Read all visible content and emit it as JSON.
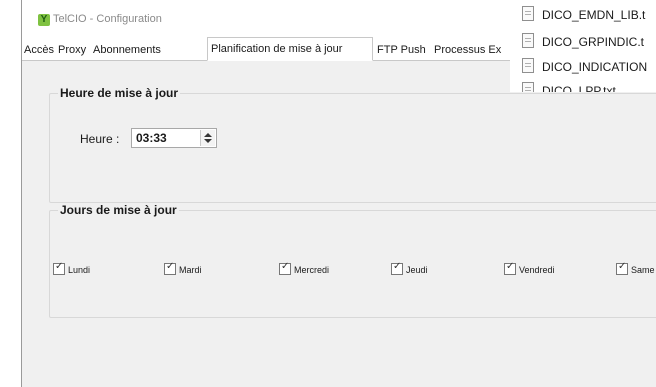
{
  "window": {
    "title": "TelCIO - Configuration"
  },
  "tabs": [
    {
      "label": "Accès"
    },
    {
      "label": "Proxy"
    },
    {
      "label": "Abonnements"
    },
    {
      "label": "Planification de mise à jour",
      "active": true
    },
    {
      "label": "FTP Push"
    },
    {
      "label": "Processus Ex"
    }
  ],
  "update_time_group": {
    "title": "Heure de mise à jour",
    "hour_label": "Heure :",
    "hour_value": "03:33"
  },
  "update_days_group": {
    "title": "Jours de mise à jour",
    "days": [
      {
        "label": "Lundi",
        "checked": true
      },
      {
        "label": "Mardi",
        "checked": true
      },
      {
        "label": "Mercredi",
        "checked": true
      },
      {
        "label": "Jeudi",
        "checked": true
      },
      {
        "label": "Vendredi",
        "checked": true
      },
      {
        "label": "Same",
        "checked": true
      }
    ]
  },
  "file_list": [
    {
      "name": "DICO_EMDN_LIB.t"
    },
    {
      "name": "DICO_GRPINDIC.t"
    },
    {
      "name": "DICO_INDICATION"
    },
    {
      "name": "DICO_LPP.txt"
    }
  ],
  "colors": {
    "panel_background": "#f0f0f0",
    "app_icon": "#7fc241"
  }
}
